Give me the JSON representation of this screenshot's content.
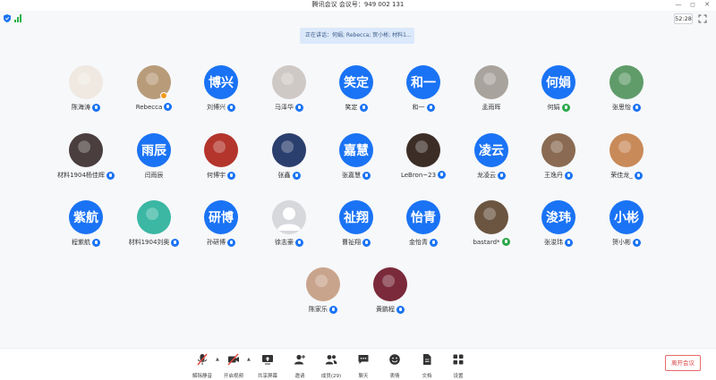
{
  "window": {
    "title": "腾讯会议 会议号：949 002 131",
    "controls": [
      "—",
      "◻",
      "✕"
    ]
  },
  "status": {
    "timer": "52:28"
  },
  "speaking_banner": "正在讲话：何娟; Rebecca; 贺小彬; 材料1...",
  "participants": [
    {
      "name": "陈海涛",
      "avatar_text": "",
      "avatar_kind": "photo",
      "avatar_color": "#efe9e1",
      "mic": "blue"
    },
    {
      "name": "Rebecca",
      "avatar_text": "",
      "avatar_kind": "photo",
      "avatar_color": "#b89c7a",
      "mic": "blue",
      "badge": true
    },
    {
      "name": "刘博兴",
      "avatar_text": "博兴",
      "avatar_kind": "text",
      "mic": "blue"
    },
    {
      "name": "马泽华",
      "avatar_text": "",
      "avatar_kind": "photo",
      "avatar_color": "#cfc9c6",
      "mic": "blue"
    },
    {
      "name": "笑定",
      "avatar_text": "笑定",
      "avatar_kind": "text",
      "mic": "blue"
    },
    {
      "name": "和一",
      "avatar_text": "和一",
      "avatar_kind": "text",
      "mic": "blue"
    },
    {
      "name": "孟雨晖",
      "avatar_text": "",
      "avatar_kind": "photo",
      "avatar_color": "#a9a39d",
      "mic": "none"
    },
    {
      "name": "何娟",
      "avatar_text": "何娟",
      "avatar_kind": "text",
      "mic": "green"
    },
    {
      "name": "张思怡",
      "avatar_text": "",
      "avatar_kind": "photo",
      "avatar_color": "#5f9c6a",
      "mic": "blue"
    },
    {
      "name": "材料1904杨佳辉",
      "avatar_text": "",
      "avatar_kind": "photo",
      "avatar_color": "#4a3e3e",
      "mic": "blue"
    },
    {
      "name": "闫雨辰",
      "avatar_text": "雨辰",
      "avatar_kind": "text",
      "mic": "none"
    },
    {
      "name": "何博宇",
      "avatar_text": "",
      "avatar_kind": "photo",
      "avatar_color": "#b3352c",
      "mic": "blue"
    },
    {
      "name": "张鑫",
      "avatar_text": "",
      "avatar_kind": "photo",
      "avatar_color": "#2b3f6e",
      "mic": "blue"
    },
    {
      "name": "张嘉慧",
      "avatar_text": "嘉慧",
      "avatar_kind": "text",
      "mic": "blue"
    },
    {
      "name": "LeBron~23",
      "avatar_text": "",
      "avatar_kind": "photo",
      "avatar_color": "#3c2e27",
      "mic": "blue"
    },
    {
      "name": "龙凌云",
      "avatar_text": "凌云",
      "avatar_kind": "text",
      "mic": "blue"
    },
    {
      "name": "王逸丹",
      "avatar_text": "",
      "avatar_kind": "photo",
      "avatar_color": "#8a6a52",
      "mic": "blue"
    },
    {
      "name": "荣佳龙_",
      "avatar_text": "",
      "avatar_kind": "photo",
      "avatar_color": "#c98a5a",
      "mic": "blue"
    },
    {
      "name": "程紫航",
      "avatar_text": "紫航",
      "avatar_kind": "text",
      "mic": "blue"
    },
    {
      "name": "材料1904刘奥",
      "avatar_text": "",
      "avatar_kind": "photo",
      "avatar_color": "#3bb7a4",
      "mic": "blue"
    },
    {
      "name": "孙研博",
      "avatar_text": "研博",
      "avatar_kind": "text",
      "mic": "blue"
    },
    {
      "name": "徐志豪",
      "avatar_text": "",
      "avatar_kind": "default",
      "avatar_color": "#d6d8dc",
      "mic": "blue"
    },
    {
      "name": "曹祉翔",
      "avatar_text": "祉翔",
      "avatar_kind": "text",
      "mic": "blue"
    },
    {
      "name": "金怡青",
      "avatar_text": "怡青",
      "avatar_kind": "text",
      "mic": "blue"
    },
    {
      "name": "bastard*",
      "avatar_text": "",
      "avatar_kind": "photo",
      "avatar_color": "#6b5540",
      "mic": "green"
    },
    {
      "name": "张浚玮",
      "avatar_text": "浚玮",
      "avatar_kind": "text",
      "mic": "blue"
    },
    {
      "name": "贺小彬",
      "avatar_text": "小彬",
      "avatar_kind": "text",
      "mic": "blue"
    },
    {
      "name": "陈家乐",
      "avatar_text": "",
      "avatar_kind": "photo",
      "avatar_color": "#c9a48c",
      "mic": "blue"
    },
    {
      "name": "黄鹏程",
      "avatar_text": "",
      "avatar_kind": "photo",
      "avatar_color": "#7a2a3a",
      "mic": "blue"
    }
  ],
  "toolbar": {
    "unmute": "解除静音",
    "video": "开启视频",
    "share": "共享屏幕",
    "invite": "邀请",
    "members": "成员(29)",
    "chat": "聊天",
    "reactions": "表情",
    "docs": "文档",
    "settings": "设置",
    "leave": "离开会议"
  },
  "colors": {
    "accent": "#1a73f4",
    "speaking": "#2aa84a",
    "leave": "#d94545"
  }
}
